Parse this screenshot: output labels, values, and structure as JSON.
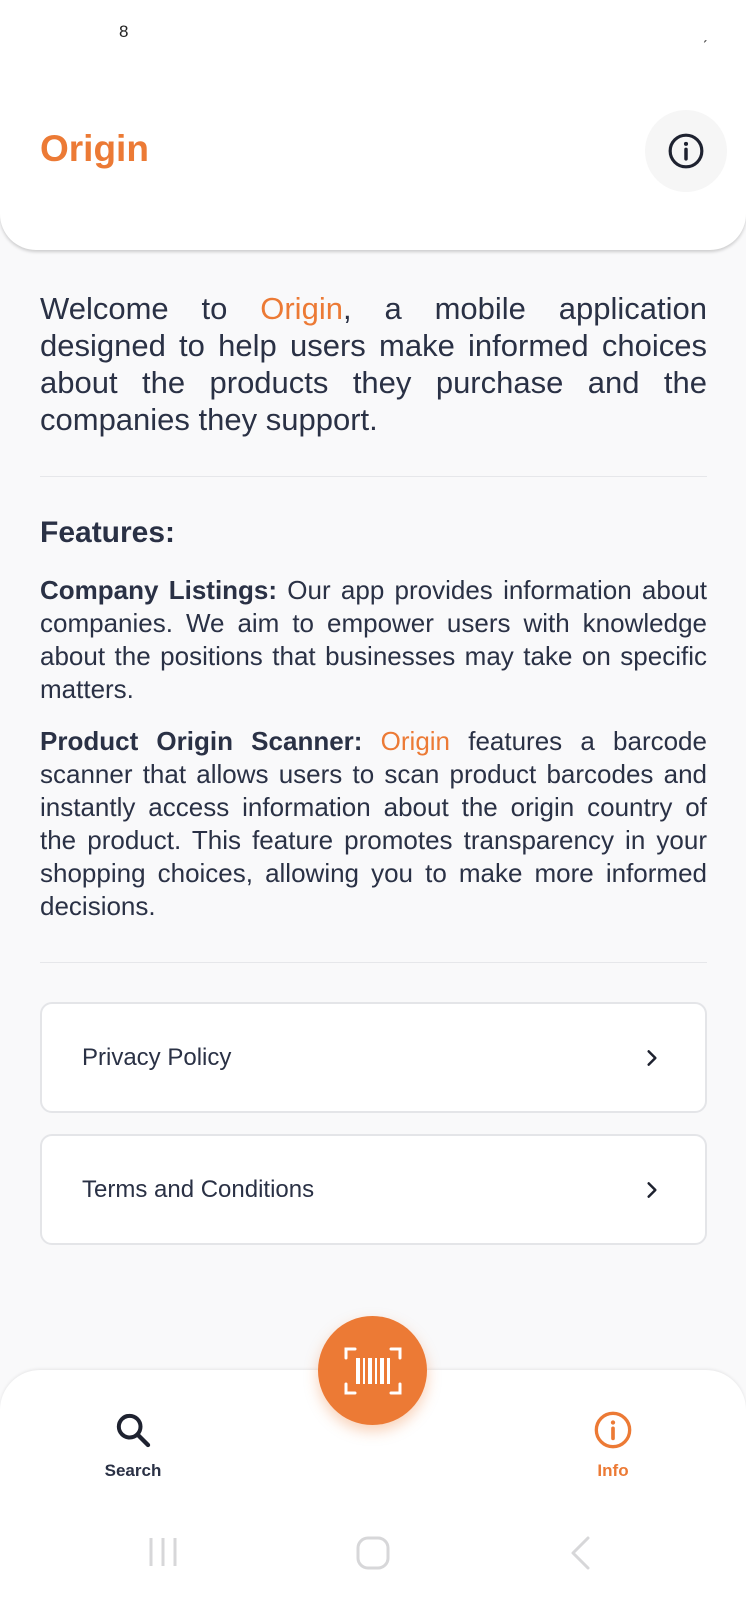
{
  "status_bar": {
    "time": "8",
    "right_indicator": "ˏ"
  },
  "header": {
    "title": "Origin",
    "info_icon": "info-icon"
  },
  "intro": {
    "prefix": "Welcome to ",
    "brand": "Origin",
    "suffix": ", a mobile application designed to help users make informed choices about the products they purchase and the companies they support."
  },
  "features": {
    "title": "Features:",
    "company_listings": {
      "heading": "Company Listings:",
      "text": " Our app provides information about companies. We aim to empower users with knowledge about the positions that businesses may take on specific matters."
    },
    "scanner": {
      "heading": "Product Origin Scanner:",
      "brand": "Origin",
      "text": " features a barcode scanner that allows users to scan product barcodes and instantly access information about the origin country of the product. This feature promotes transparency in your shopping choices, allowing you to make more informed decisions."
    }
  },
  "links": [
    {
      "label": "Privacy Policy",
      "icon": "chevron-right-icon"
    },
    {
      "label": "Terms and Conditions",
      "icon": "chevron-right-icon"
    }
  ],
  "bottom_nav": {
    "search_label": "Search",
    "info_label": "Info",
    "scan_icon": "barcode-scan-icon",
    "active": "Info"
  },
  "colors": {
    "accent": "#ec7a35",
    "text": "#2a3145",
    "background": "#f9f9fa"
  }
}
